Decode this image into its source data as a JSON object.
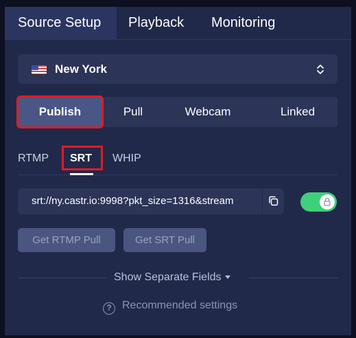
{
  "tabs": [
    {
      "label": "Source Setup",
      "active": true
    },
    {
      "label": "Playback",
      "active": false
    },
    {
      "label": "Monitoring",
      "active": false
    }
  ],
  "region": {
    "label": "New York",
    "flag_icon": "us-flag-icon",
    "selector_icon": "chevron-up-down-icon"
  },
  "modes": [
    {
      "label": "Publish",
      "active": true
    },
    {
      "label": "Pull",
      "active": false
    },
    {
      "label": "Webcam",
      "active": false
    },
    {
      "label": "Linked",
      "active": false
    }
  ],
  "protocols": [
    {
      "label": "RTMP",
      "active": false
    },
    {
      "label": "SRT",
      "active": true
    },
    {
      "label": "WHIP",
      "active": false
    }
  ],
  "stream_url": {
    "value": "srt://ny.castr.io:9998?pkt_size=1316&stream",
    "copy_icon": "copy-icon"
  },
  "lock_toggle": {
    "enabled": true,
    "icon": "lock-icon",
    "color": "#3fd07a"
  },
  "buttons": {
    "rtmp_pull": "Get RTMP Pull",
    "srt_pull": "Get SRT Pull"
  },
  "separate_fields": {
    "label": "Show Separate Fields"
  },
  "recommended": {
    "label": "Recommended settings",
    "icon": "question-circle-icon"
  },
  "colors": {
    "panel": "#21294a",
    "highlight": "#e01b24",
    "accent": "#3fd07a"
  }
}
